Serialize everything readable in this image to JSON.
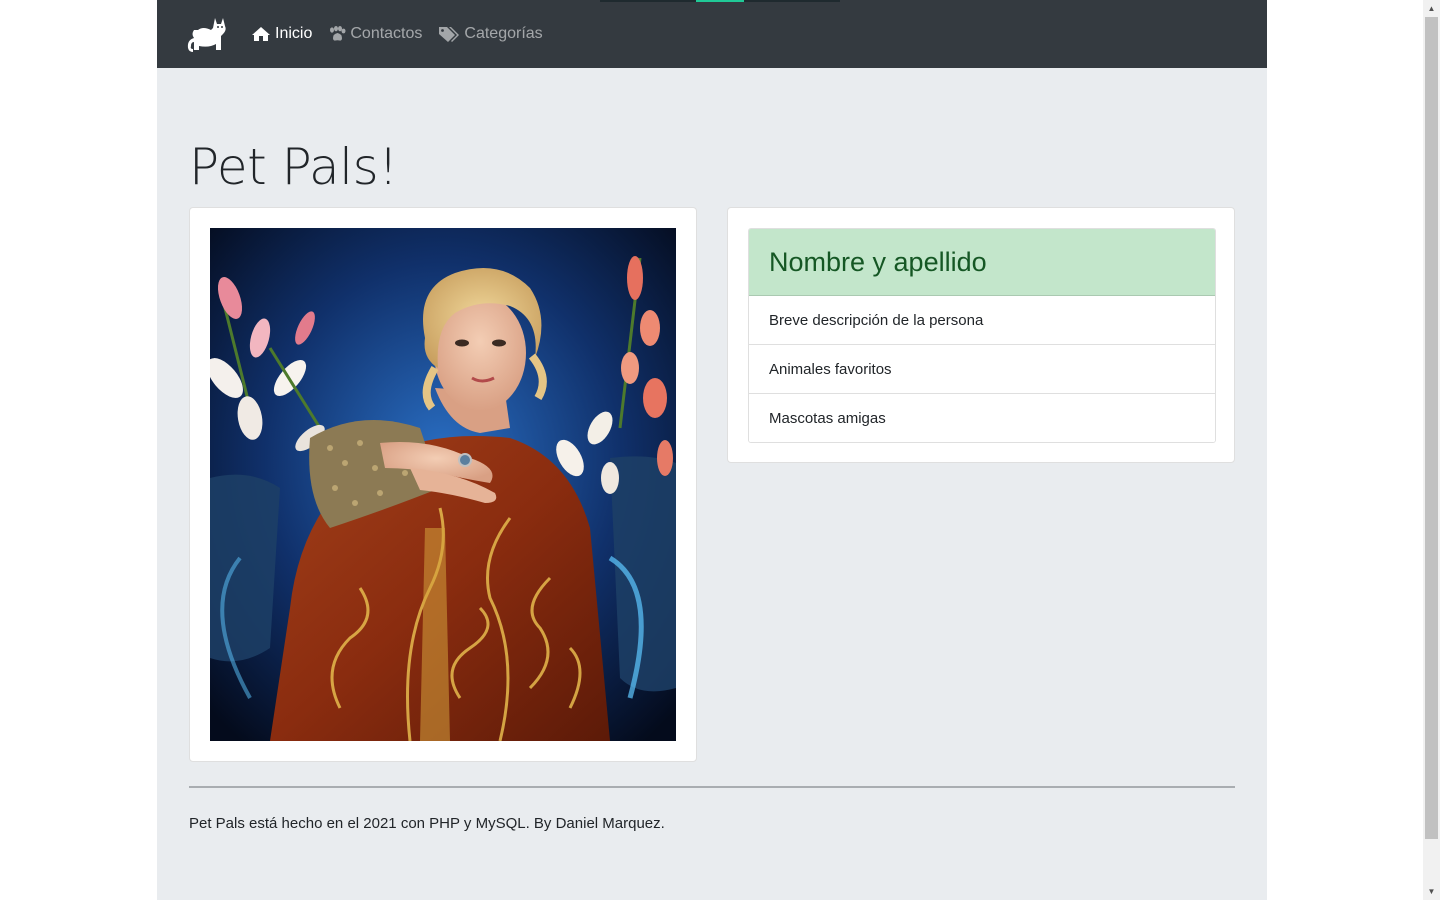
{
  "nav": {
    "items": [
      {
        "label": "Inicio",
        "icon": "home-icon",
        "active": true
      },
      {
        "label": "Contactos",
        "icon": "paw-icon",
        "active": false
      },
      {
        "label": "Categorías",
        "icon": "tags-icon",
        "active": false
      }
    ]
  },
  "page": {
    "title": "Pet Pals!"
  },
  "profile": {
    "name": "Nombre y apellido",
    "details": [
      "Breve descripción de la persona",
      "Animales favoritos",
      "Mascotas amigas"
    ]
  },
  "footer": {
    "text": "Pet Pals está hecho en el 2021 con PHP y MySQL. By Daniel Marquez."
  },
  "colors": {
    "navbar": "#343a40",
    "page_bg": "#e9ecef",
    "header_bg": "#c3e6cb",
    "header_text": "#155724"
  }
}
